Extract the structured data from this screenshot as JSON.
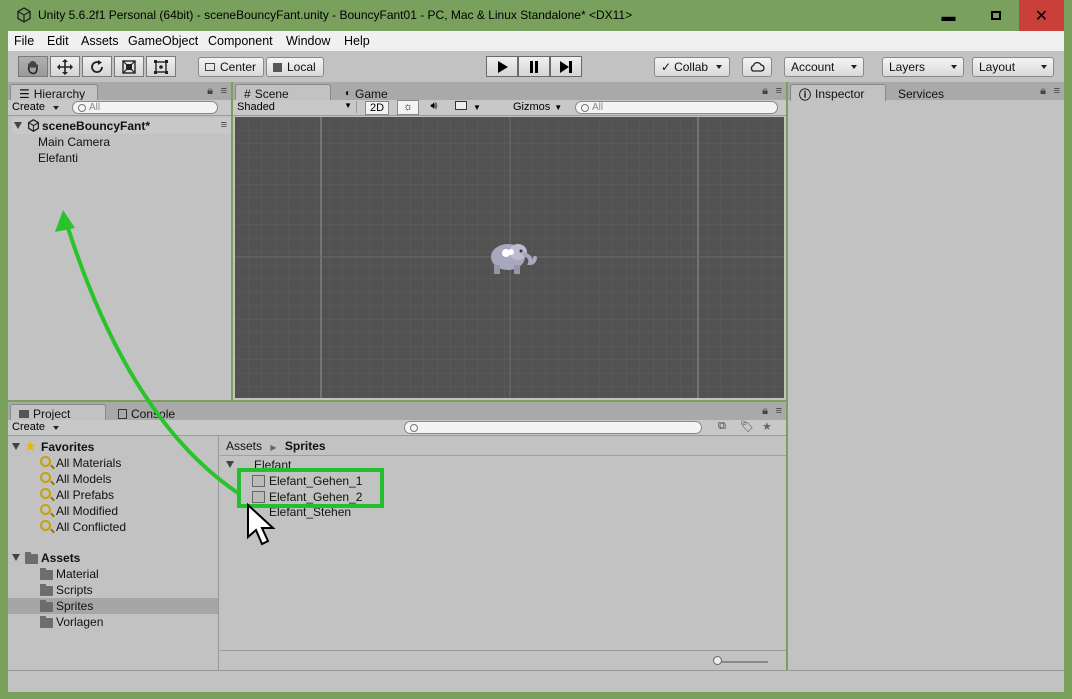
{
  "window": {
    "title": "Unity 5.6.2f1 Personal (64bit) - sceneBouncyFant.unity - BouncyFant01 - PC, Mac & Linux Standalone* <DX11>"
  },
  "menu": [
    "File",
    "Edit",
    "Assets",
    "GameObject",
    "Component",
    "Window",
    "Help"
  ],
  "toolbar": {
    "center": "Center",
    "local": "Local",
    "collab": "Collab",
    "account": "Account",
    "layers": "Layers",
    "layout": "Layout"
  },
  "hierarchy": {
    "tab": "Hierarchy",
    "create": "Create",
    "search_placeholder": "All",
    "scene": "sceneBouncyFant*",
    "items": [
      "Main Camera",
      "Elefanti"
    ]
  },
  "scene": {
    "tab_scene": "Scene",
    "tab_game": "Game",
    "shading": "Shaded",
    "mode2d": "2D",
    "gizmos": "Gizmos",
    "search_placeholder": "All"
  },
  "inspector": {
    "tab": "Inspector",
    "services": "Services"
  },
  "project": {
    "tab_project": "Project",
    "tab_console": "Console",
    "create": "Create",
    "favorites_label": "Favorites",
    "favorites": [
      "All Materials",
      "All Models",
      "All Prefabs",
      "All Modified",
      "All Conflicted"
    ],
    "assets_label": "Assets",
    "folders": [
      "Material",
      "Scripts",
      "Sprites",
      "Vorlagen"
    ],
    "breadcrumb": [
      "Assets",
      "Sprites"
    ],
    "group": "Elefant",
    "files": [
      "Elefant_Gehen_1",
      "Elefant_Gehen_2",
      "Elefant_Stehen"
    ]
  },
  "colors": {
    "highlight": "#22c12b",
    "arrow": "#2bc32b",
    "close": "#c9403a",
    "selection": "#a6a6a6"
  }
}
